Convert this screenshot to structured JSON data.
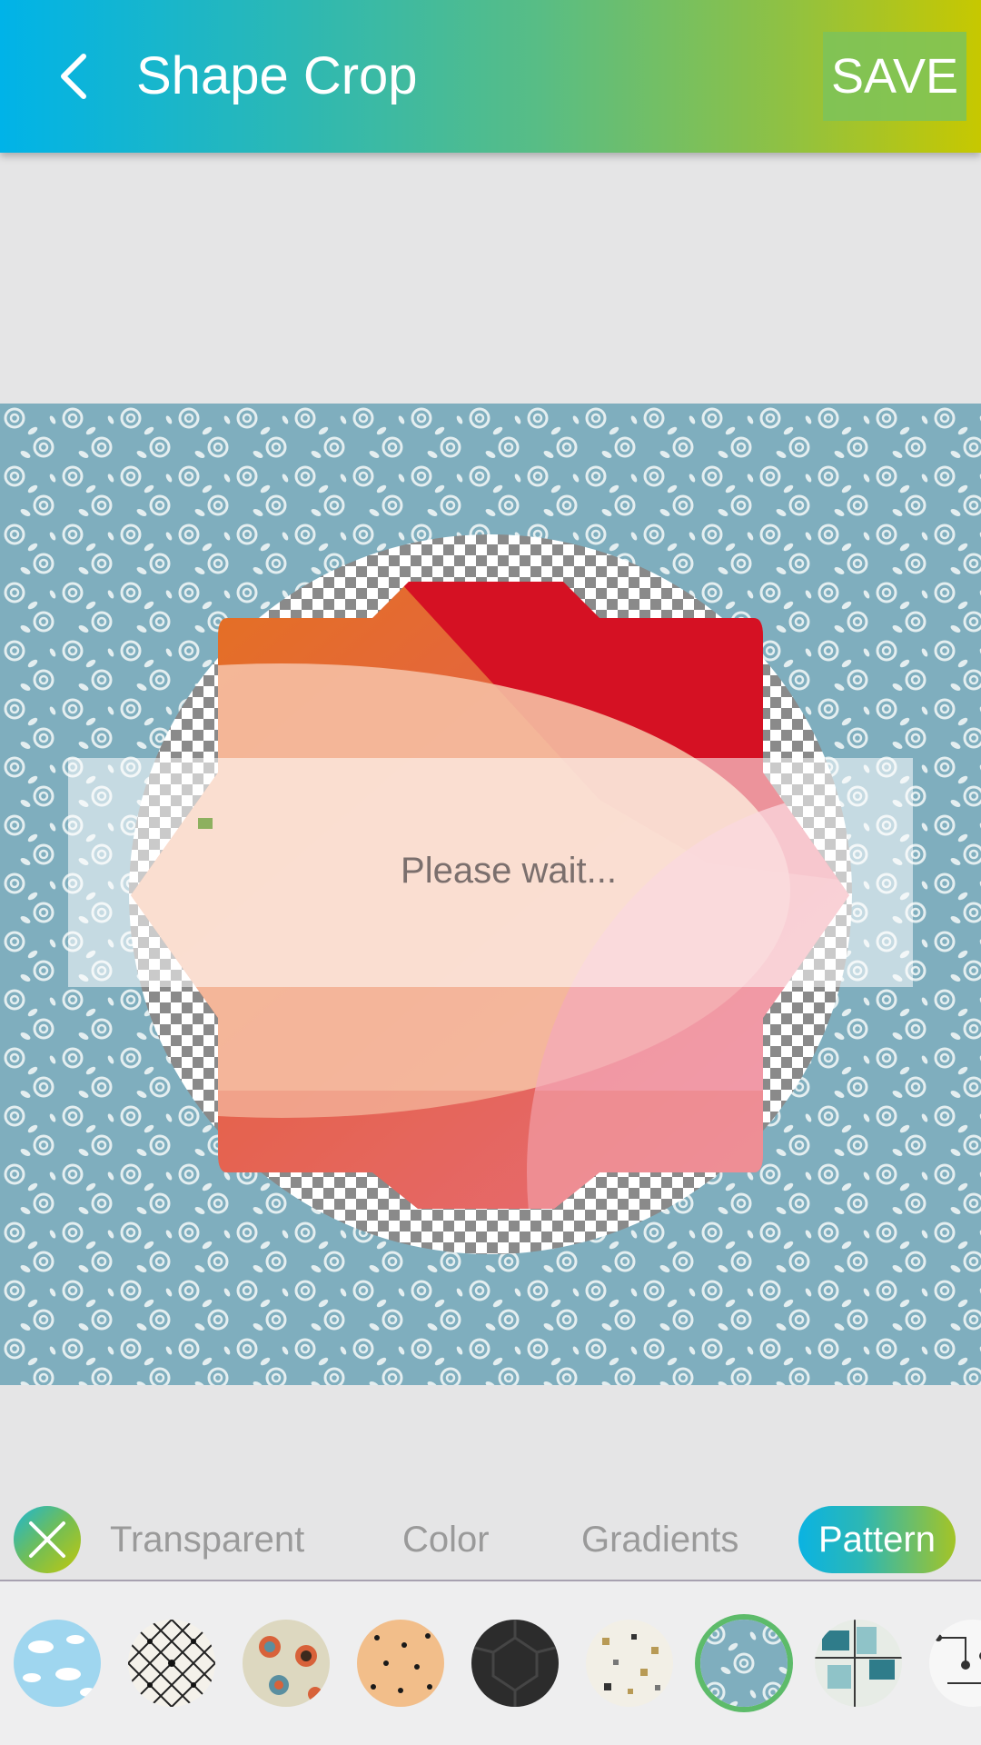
{
  "app_bar": {
    "title": "Shape Crop",
    "save_label": "SAVE"
  },
  "loading": {
    "message": "Please wait..."
  },
  "background_tabs": [
    {
      "label": "Transparent",
      "active": false
    },
    {
      "label": "Color",
      "active": false
    },
    {
      "label": "Gradients",
      "active": false
    },
    {
      "label": "Pattern",
      "active": true
    }
  ],
  "patterns": [
    {
      "name": "clouds",
      "selected": false
    },
    {
      "name": "diamond-lattice",
      "selected": false
    },
    {
      "name": "retro-circles",
      "selected": false
    },
    {
      "name": "dots-peach",
      "selected": false
    },
    {
      "name": "dark-tiles",
      "selected": false
    },
    {
      "name": "confetti-squares",
      "selected": false
    },
    {
      "name": "roses-blue",
      "selected": true
    },
    {
      "name": "geo-teal",
      "selected": false
    },
    {
      "name": "lines-white",
      "selected": false
    }
  ],
  "colors": {
    "accent_start": "#00b3e8",
    "accent_end": "#c7c800",
    "pattern_blue": "#7faebe",
    "selected_ring": "#5dbb6a"
  }
}
